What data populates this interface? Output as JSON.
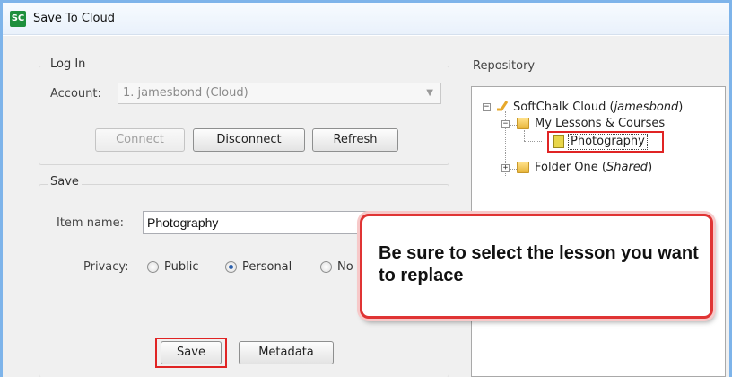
{
  "window": {
    "icon_text": "SC",
    "title": "Save To Cloud"
  },
  "login": {
    "group_label": "Log In",
    "account_label": "Account:",
    "account_value": "1. jamesbond (Cloud)",
    "connect_label": "Connect",
    "disconnect_label": "Disconnect",
    "refresh_label": "Refresh"
  },
  "save": {
    "group_label": "Save",
    "item_name_label": "Item name:",
    "item_name_value": "Photography",
    "privacy_label": "Privacy:",
    "privacy_options": [
      {
        "label": "Public",
        "checked": false
      },
      {
        "label": "Personal",
        "checked": true
      },
      {
        "label": "No",
        "checked": false
      }
    ],
    "save_label": "Save",
    "metadata_label": "Metadata"
  },
  "repository": {
    "label": "Repository",
    "root": {
      "name": "SoftChalk Cloud",
      "suffix": "jamesbond"
    },
    "nodes": [
      {
        "label": "My Lessons & Courses",
        "suffix": ""
      },
      {
        "label": "Photography",
        "suffix": ""
      },
      {
        "label": "Folder One",
        "suffix": "Shared"
      }
    ]
  },
  "callout": {
    "text": "Be sure to select the lesson you want to replace"
  },
  "colors": {
    "highlight_red": "#e02424",
    "window_border": "#7eb4ea",
    "app_icon_green": "#1d8f3c"
  }
}
